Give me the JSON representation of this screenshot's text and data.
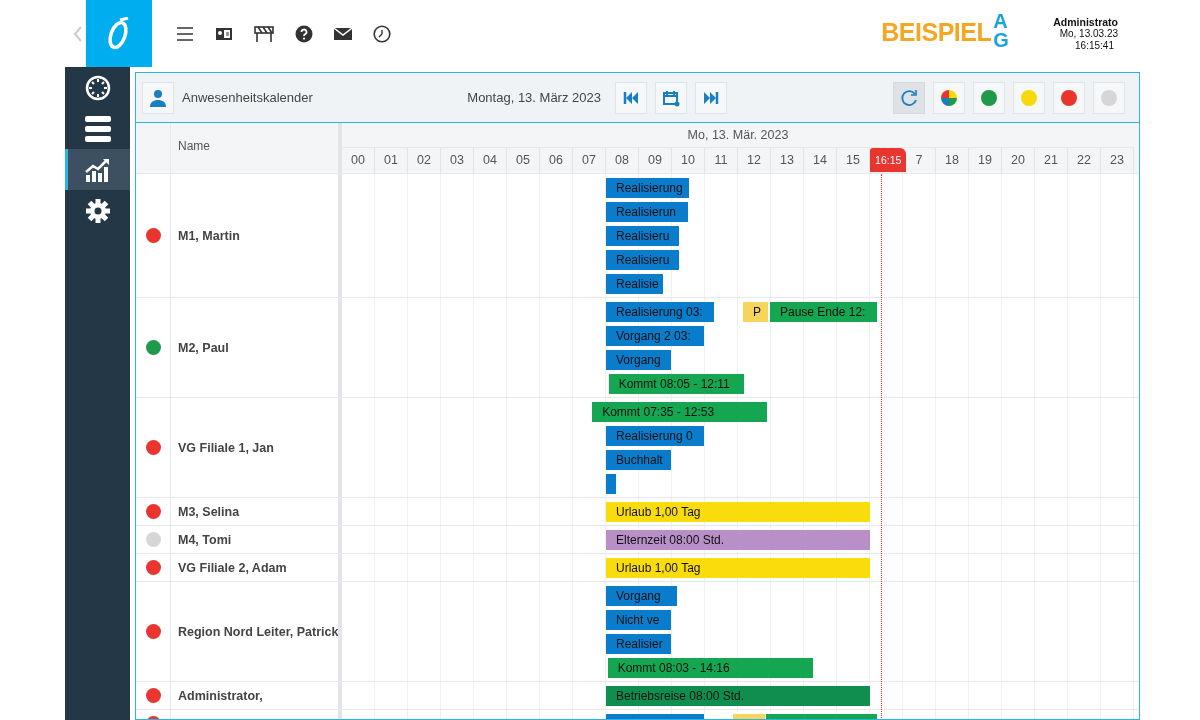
{
  "topbar": {
    "brand": {
      "name": "BEISPIEL",
      "suffix": "AG"
    },
    "user": {
      "name": "Administrato",
      "date": "Mo, 13.03.23",
      "time": "16:15:41"
    }
  },
  "sidebar": {
    "items": [
      {
        "kind": "dashboard",
        "selected": false
      },
      {
        "kind": "list",
        "selected": false
      },
      {
        "kind": "chart",
        "selected": true
      },
      {
        "kind": "settings",
        "selected": false
      }
    ]
  },
  "toolbar": {
    "title": "Anwesenheitskalender",
    "date": "Montag, 13. März 2023",
    "filters": [
      {
        "kind": "refresh",
        "selected": true
      },
      {
        "kind": "all",
        "selected": false
      },
      {
        "kind": "status",
        "color": "#1f9a4a",
        "selected": false
      },
      {
        "kind": "status",
        "color": "#f5d90a",
        "selected": false
      },
      {
        "kind": "status",
        "color": "#e8352e",
        "selected": false
      },
      {
        "kind": "status",
        "color": "#d6d6d6",
        "selected": false
      }
    ]
  },
  "calendar": {
    "name_header": "Name",
    "day": "Mo, 13. Mär. 2023",
    "hours": [
      "00",
      "01",
      "02",
      "03",
      "04",
      "05",
      "06",
      "07",
      "08",
      "09",
      "10",
      "11",
      "12",
      "13",
      "14",
      "15",
      "7",
      "18",
      "19",
      "20",
      "21",
      "22",
      "23"
    ],
    "now": {
      "label": "16:15"
    },
    "employees": [
      {
        "name": "M1, Martin",
        "color": "#e8352e",
        "lanes": [
          [
            {
              "label": "Realisierung",
              "color": "#0a7ccc"
            }
          ],
          [
            {
              "label": "Realisierun",
              "color": "#0a7ccc"
            }
          ],
          [
            {
              "label": "Realisieru",
              "color": "#0a7ccc"
            }
          ],
          [
            {
              "label": "Realisieru",
              "color": "#0a7ccc"
            }
          ],
          [
            {
              "label": "Realisie",
              "color": "#0a7ccc"
            }
          ]
        ]
      },
      {
        "name": "M2, Paul",
        "color": "#1f9a4a",
        "lanes": [
          [
            {
              "label": "Realisierung 03:",
              "color": "#0a7ccc"
            },
            {
              "label": "P",
              "color": "#f7d55c"
            },
            {
              "label": "Pause Ende 12:",
              "color": "#14a651"
            }
          ],
          [
            {
              "label": "Vorgang 2 03:",
              "color": "#0a7ccc"
            }
          ],
          [
            {
              "label": "Vorgang",
              "color": "#0a7ccc"
            }
          ],
          [
            {
              "label": "Kommt 08:05 - 12:11",
              "color": "#14a651"
            }
          ]
        ]
      },
      {
        "name": "VG Filiale 1, Jan",
        "color": "#e8352e",
        "lanes": [
          [
            {
              "label": "Kommt 07:35 - 12:53",
              "color": "#14a651"
            }
          ],
          [
            {
              "label": "Realisierung 0",
              "color": "#0a7ccc"
            }
          ],
          [
            {
              "label": "Buchhalt",
              "color": "#0a7ccc"
            }
          ],
          [
            {
              "color": "#0a7ccc"
            }
          ]
        ]
      },
      {
        "name": "M3, Selina",
        "color": "#e8352e",
        "lanes": [
          [
            {
              "label": "Urlaub 1,00 Tag",
              "color": "#f9dc0c"
            }
          ]
        ]
      },
      {
        "name": "M4, Tomi",
        "color": "#d6d6d6",
        "lanes": [
          [
            {
              "label": "Elternzeit 08:00 Std.",
              "color": "#b98fc8"
            }
          ]
        ]
      },
      {
        "name": "VG Filiale 2, Adam",
        "color": "#e8352e",
        "lanes": [
          [
            {
              "label": "Urlaub 1,00 Tag",
              "color": "#f9dc0c"
            }
          ]
        ]
      },
      {
        "name": "Region Nord Leiter, Patrick",
        "color": "#e8352e",
        "lanes": [
          [
            {
              "label": "Vorgang",
              "color": "#0a7ccc"
            }
          ],
          [
            {
              "label": "Nicht ve",
              "color": "#0a7ccc"
            }
          ],
          [
            {
              "label": "Realisier",
              "color": "#0a7ccc"
            }
          ],
          [
            {
              "label": "Kommt 08:03 - 14:16",
              "color": "#14a651"
            }
          ]
        ]
      },
      {
        "name": "Administrator,",
        "color": "#e8352e",
        "lanes": [
          [
            {
              "label": "Betriebsreise 08:00 Std.",
              "color": "#0e8f4f"
            }
          ]
        ]
      },
      {
        "color": "#e8352e",
        "lanes": [
          [
            {
              "color": "#0a7ccc"
            },
            {
              "color": "#f7d55c"
            },
            {
              "color": "#14a651"
            }
          ]
        ]
      }
    ]
  }
}
